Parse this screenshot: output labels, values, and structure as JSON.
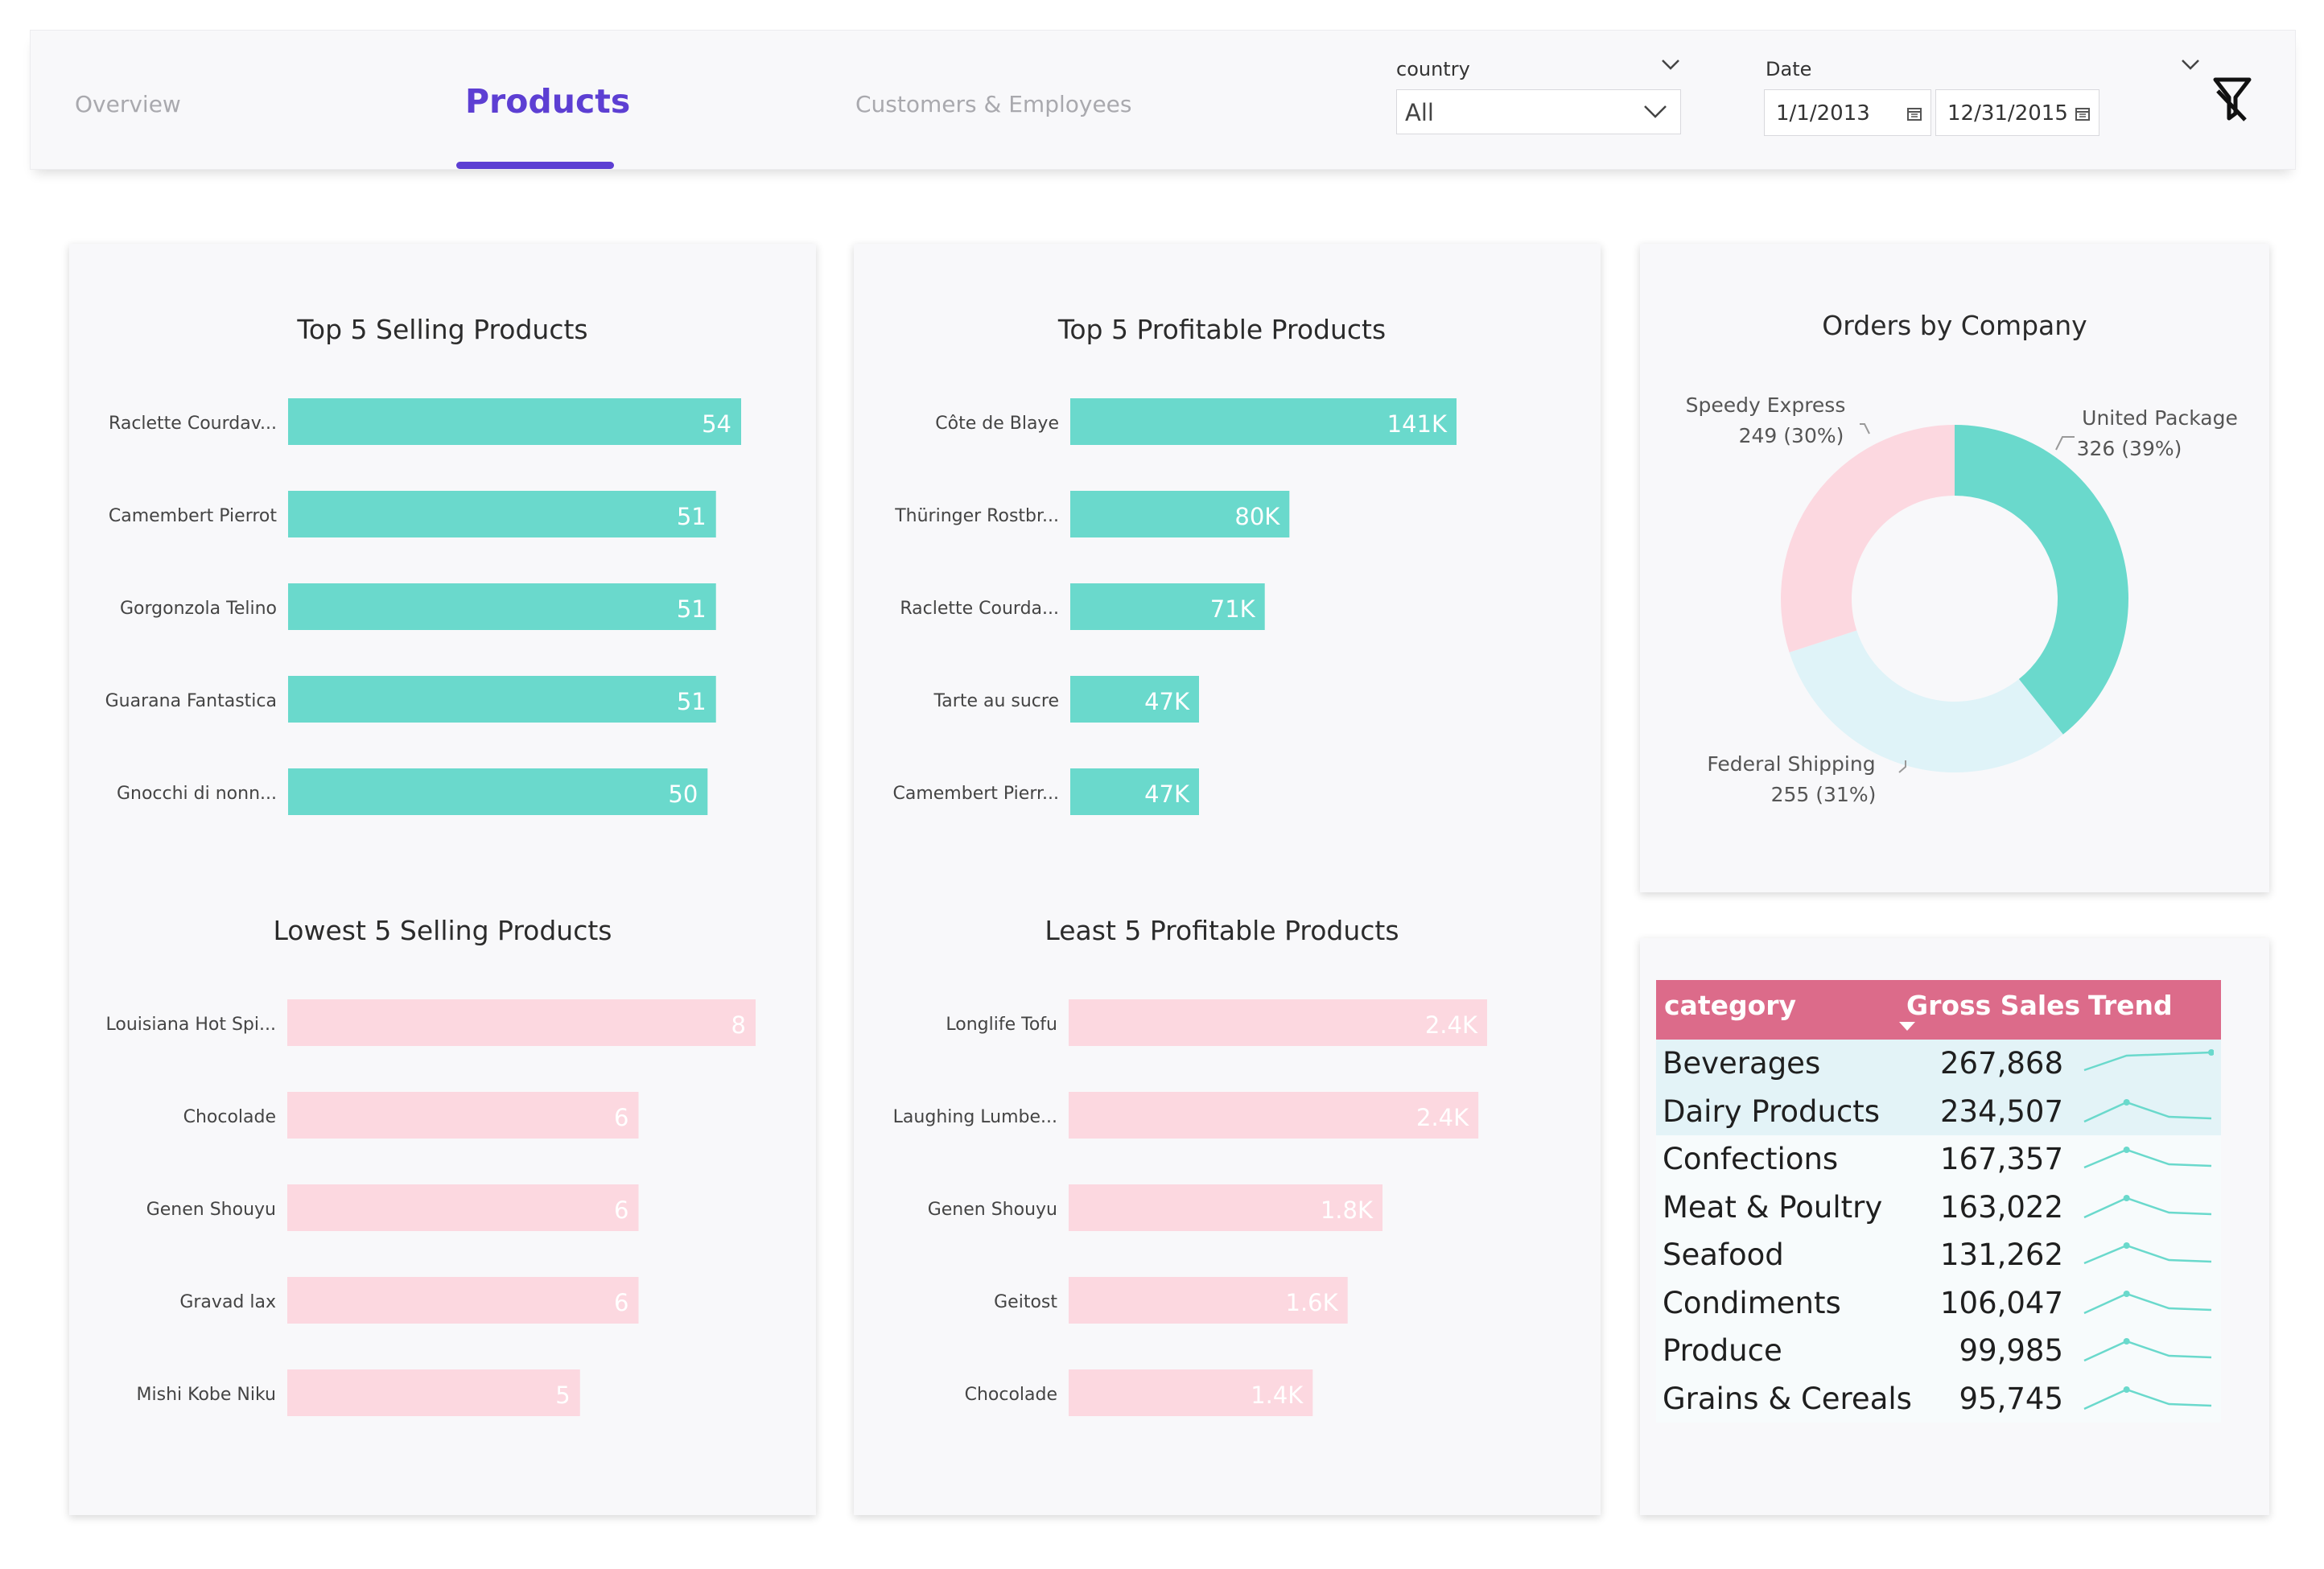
{
  "nav": {
    "tabs": [
      {
        "label": "Overview"
      },
      {
        "label": "Products"
      },
      {
        "label": "Customers & Employees"
      }
    ]
  },
  "filters": {
    "country": {
      "title": "country",
      "value": "All"
    },
    "date": {
      "title": "Date",
      "start": "1/1/2013",
      "end": "12/31/2015"
    }
  },
  "colors": {
    "accent": "#5d3fd3",
    "teal_bar": "#6ad9cc",
    "pink_bar": "#fcd8e0",
    "header_pink": "#dc6b8a",
    "donut_pink": "#fcd8e0",
    "donut_light": "#dff3f8"
  },
  "charts": {
    "top_selling": {
      "title": "Top 5 Selling Products"
    },
    "top_profit": {
      "title": "Top 5 Profitable Products"
    },
    "low_selling": {
      "title": "Lowest 5 Selling Products"
    },
    "least_profit": {
      "title": "Least 5 Profitable Products"
    },
    "orders": {
      "title": "Orders by Company"
    }
  },
  "chart_data": [
    {
      "type": "bar",
      "orientation": "horizontal",
      "title": "Top 5 Selling Products",
      "categories": [
        "Raclette Courdav...",
        "Camembert Pierrot",
        "Gorgonzola Telino",
        "Guarana Fantastica",
        "Gnocchi di nonn..."
      ],
      "values": [
        54,
        51,
        51,
        51,
        50
      ],
      "labels": [
        "54",
        "51",
        "51",
        "51",
        "50"
      ],
      "xlim": [
        0,
        54
      ]
    },
    {
      "type": "bar",
      "orientation": "horizontal",
      "title": "Top 5 Profitable Products",
      "categories": [
        "Côte de Blaye",
        "Thüringer Rostbr...",
        "Raclette Courda...",
        "Tarte au sucre",
        "Camembert Pierr..."
      ],
      "values": [
        141000,
        80000,
        71000,
        47000,
        47000
      ],
      "labels": [
        "141K",
        "80K",
        "71K",
        "47K",
        "47K"
      ],
      "xlim": [
        0,
        141000
      ]
    },
    {
      "type": "bar",
      "orientation": "horizontal",
      "title": "Lowest 5 Selling Products",
      "categories": [
        "Louisiana Hot Spi...",
        "Chocolade",
        "Genen Shouyu",
        "Gravad lax",
        "Mishi Kobe Niku"
      ],
      "values": [
        8,
        6,
        6,
        6,
        5
      ],
      "labels": [
        "8",
        "6",
        "6",
        "6",
        "5"
      ],
      "xlim": [
        0,
        8
      ]
    },
    {
      "type": "bar",
      "orientation": "horizontal",
      "title": "Least 5 Profitable Products",
      "categories": [
        "Longlife Tofu",
        "Laughing Lumbe...",
        "Genen Shouyu",
        "Geitost",
        "Chocolade"
      ],
      "values": [
        2400,
        2350,
        1800,
        1600,
        1400
      ],
      "labels": [
        "2.4K",
        "2.4K",
        "1.8K",
        "1.6K",
        "1.4K"
      ],
      "xlim": [
        0,
        2400
      ]
    },
    {
      "type": "pie",
      "variant": "donut",
      "title": "Orders by Company",
      "slices": [
        {
          "name": "United Package",
          "value": 326,
          "label": "326 (39%)",
          "color": "#6ad9cc"
        },
        {
          "name": "Federal Shipping",
          "value": 255,
          "label": "255 (31%)",
          "color": "#dff3f8"
        },
        {
          "name": "Speedy Express",
          "value": 249,
          "label": "249 (30%)",
          "color": "#fcd8e0"
        }
      ]
    },
    {
      "type": "table",
      "columns": [
        "category",
        "Gross Sales",
        "Trend"
      ],
      "rows": [
        {
          "category": "Beverages",
          "sales": "267,868",
          "trend": [
            0.3,
            0.75,
            0.8,
            0.85
          ]
        },
        {
          "category": "Dairy Products",
          "sales": "234,507",
          "trend": [
            0.2,
            0.8,
            0.35,
            0.3
          ]
        },
        {
          "category": "Confections",
          "sales": "167,357",
          "trend": [
            0.25,
            0.8,
            0.35,
            0.3
          ]
        },
        {
          "category": "Meat & Poultry",
          "sales": "163,022",
          "trend": [
            0.2,
            0.8,
            0.35,
            0.3
          ]
        },
        {
          "category": "Seafood",
          "sales": "131,262",
          "trend": [
            0.25,
            0.8,
            0.35,
            0.3
          ]
        },
        {
          "category": "Condiments",
          "sales": "106,047",
          "trend": [
            0.2,
            0.8,
            0.35,
            0.3
          ]
        },
        {
          "category": "Produce",
          "sales": "99,985",
          "trend": [
            0.2,
            0.8,
            0.35,
            0.3
          ]
        },
        {
          "category": "Grains & Cereals",
          "sales": "95,745",
          "trend": [
            0.2,
            0.8,
            0.35,
            0.3
          ]
        }
      ]
    }
  ]
}
